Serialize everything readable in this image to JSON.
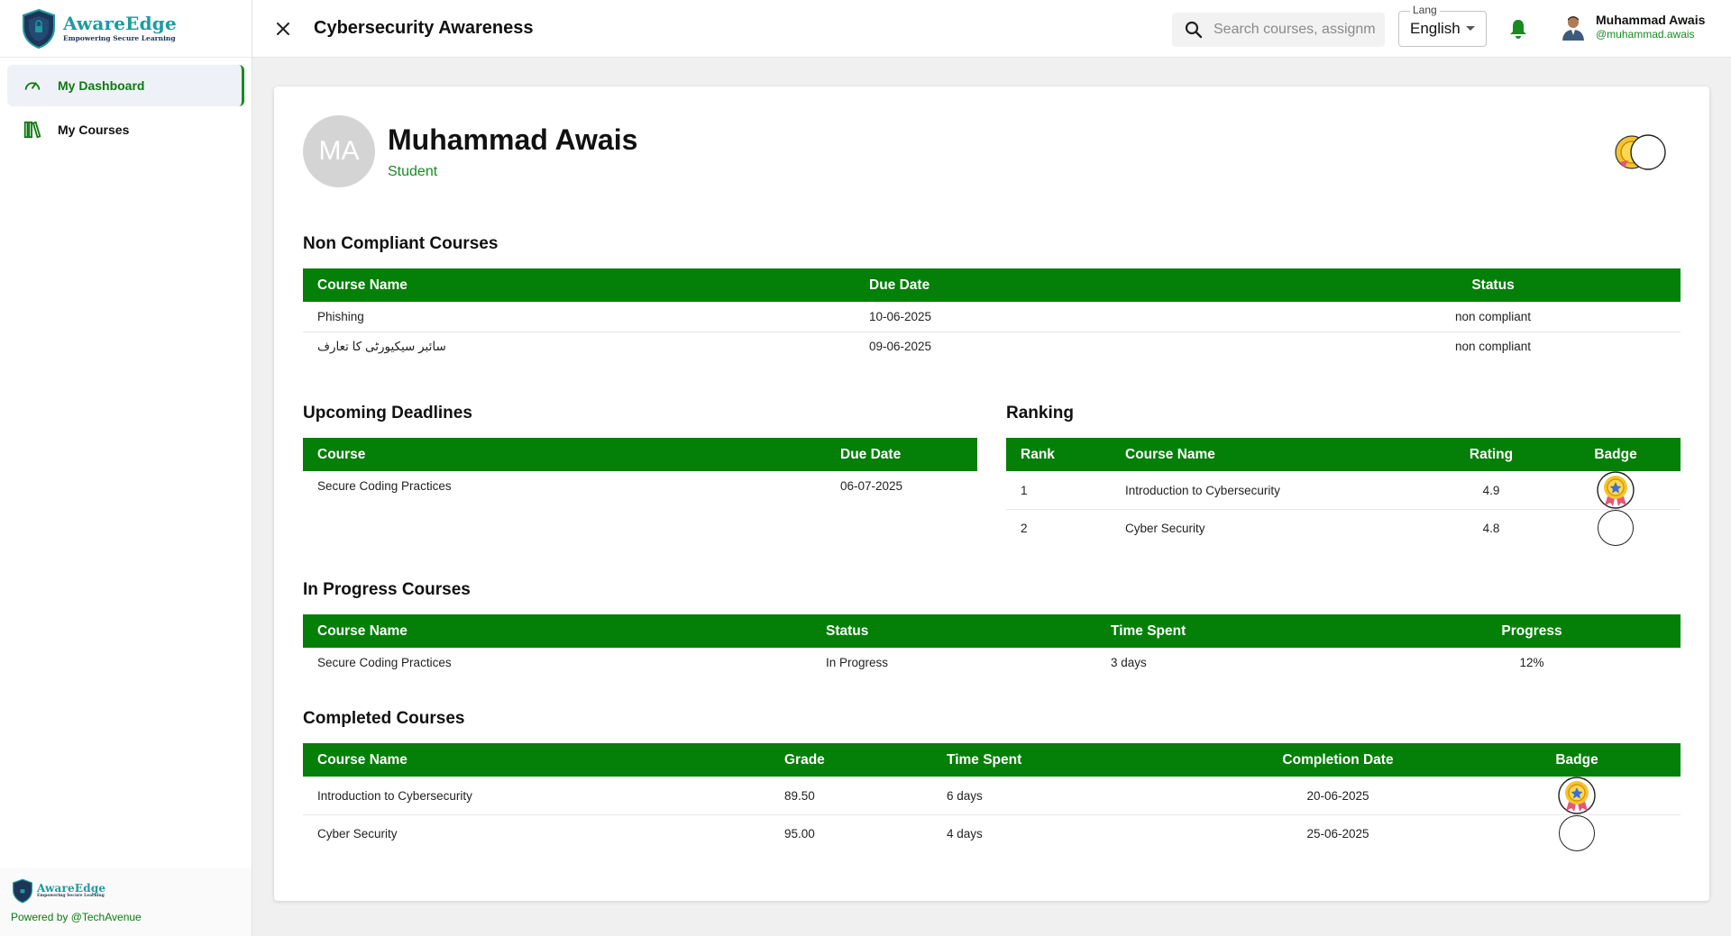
{
  "brand": {
    "name": "AwareEdge",
    "tagline": "Empowering Secure Learning"
  },
  "sidebar": {
    "items": [
      {
        "label": "My Dashboard",
        "icon": "dashboard-gauge-icon",
        "active": true
      },
      {
        "label": "My Courses",
        "icon": "library-books-icon",
        "active": false
      }
    ],
    "footer": {
      "brand_name": "AwareEdge",
      "brand_tagline": "Empowering Secure Learning",
      "powered_by": "Powered by @TechAvenue"
    }
  },
  "header": {
    "title": "Cybersecurity Awareness",
    "search_placeholder": "Search courses, assignments...",
    "lang_label": "Lang",
    "lang_value": "English",
    "user_name": "Muhammad Awais",
    "user_handle": "@muhammad.awais"
  },
  "profile": {
    "initials": "MA",
    "name": "Muhammad Awais",
    "role": "Student"
  },
  "non_compliant": {
    "title": "Non Compliant Courses",
    "columns": [
      "Course Name",
      "Due Date",
      "Status"
    ],
    "rows": [
      {
        "course": "Phishing",
        "due": "10-06-2025",
        "status": "non compliant"
      },
      {
        "course": "سائبر سیکیورٹی کا تعارف",
        "due": "09-06-2025",
        "status": "non compliant"
      }
    ]
  },
  "upcoming": {
    "title": "Upcoming Deadlines",
    "columns": [
      "Course",
      "Due Date"
    ],
    "rows": [
      {
        "course": "Secure Coding Practices",
        "due": "06-07-2025"
      }
    ]
  },
  "ranking": {
    "title": "Ranking",
    "columns": [
      "Rank",
      "Course Name",
      "Rating",
      "Badge"
    ],
    "rows": [
      {
        "rank": "1",
        "course": "Introduction to Cybersecurity",
        "rating": "4.9",
        "badge": "gold-medal-icon"
      },
      {
        "rank": "2",
        "course": "Cyber Security",
        "rating": "4.8",
        "badge": "empty-badge"
      }
    ]
  },
  "in_progress": {
    "title": "In Progress Courses",
    "columns": [
      "Course Name",
      "Status",
      "Time Spent",
      "Progress"
    ],
    "rows": [
      {
        "course": "Secure Coding Practices",
        "status": "In Progress",
        "time": "3 days",
        "progress": "12%"
      }
    ]
  },
  "completed": {
    "title": "Completed Courses",
    "columns": [
      "Course Name",
      "Grade",
      "Time Spent",
      "Completion Date",
      "Badge"
    ],
    "rows": [
      {
        "course": "Introduction to Cybersecurity",
        "grade": "89.50",
        "time": "6 days",
        "date": "20-06-2025",
        "badge": "gold-medal-icon"
      },
      {
        "course": "Cyber Security",
        "grade": "95.00",
        "time": "4 days",
        "date": "25-06-2025",
        "badge": "empty-badge"
      }
    ]
  },
  "colors": {
    "primary_green": "#047f08",
    "accent_green": "#188a21",
    "non_compliant_red": "#e01c1c",
    "brand_teal": "#1f9aa0"
  }
}
